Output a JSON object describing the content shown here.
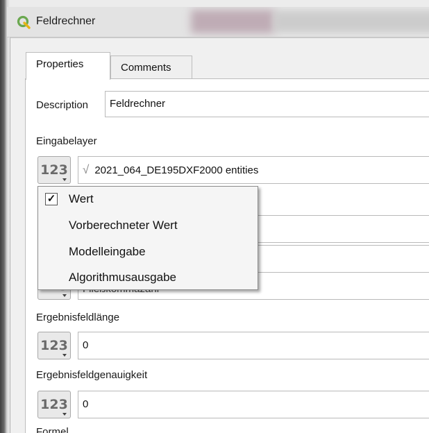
{
  "window": {
    "title": "Feldrechner"
  },
  "tabs": [
    {
      "label": "Properties",
      "active": true
    },
    {
      "label": "Comments",
      "active": false
    }
  ],
  "description": {
    "label": "Description",
    "value": "Feldrechner"
  },
  "input_layer": {
    "label": "Eingabelayer",
    "badge": "123",
    "value": "2021_064_DE195DXF2000 entities",
    "value_icon": "sqrt-icon"
  },
  "value_source_menu": {
    "items": [
      {
        "label": "Wert",
        "checked": true
      },
      {
        "label": "Vorberechneter Wert",
        "checked": false
      },
      {
        "label": "Modelleingabe",
        "checked": false
      },
      {
        "label": "Algorithmusausgabe",
        "checked": false
      }
    ]
  },
  "obscured_field": {
    "badge": "123",
    "value": "Fließkommazahl"
  },
  "result_length": {
    "label": "Ergebnisfeldlänge",
    "badge": "123",
    "value": "0"
  },
  "result_precision": {
    "label": "Ergebnisfeldgenauigkeit",
    "badge": "123",
    "value": "0"
  },
  "formula": {
    "label": "Formel"
  },
  "colors": {
    "badge_text": "#6a6a6a",
    "logo_green": "#6aa84f"
  }
}
